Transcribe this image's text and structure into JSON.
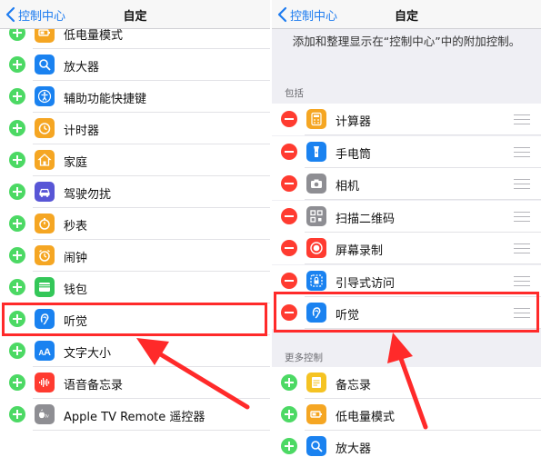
{
  "colors": {
    "ios_blue": "#1e7cf0",
    "add_green": "#4cd964",
    "remove_red": "#ff3b30",
    "highlight_red": "#ff2a2a"
  },
  "left": {
    "nav": {
      "back_label": "控制中心",
      "title": "自定"
    },
    "rows": [
      {
        "label": "低电量模式",
        "icon": "battery-icon",
        "icon_color": "#f5a623"
      },
      {
        "label": "放大器",
        "icon": "magnifier-icon",
        "icon_color": "#1a82f0"
      },
      {
        "label": "辅助功能快捷键",
        "icon": "accessibility-icon",
        "icon_color": "#1a82f0"
      },
      {
        "label": "计时器",
        "icon": "timer-icon",
        "icon_color": "#f5a623"
      },
      {
        "label": "家庭",
        "icon": "home-icon",
        "icon_color": "#f5a623"
      },
      {
        "label": "驾驶勿扰",
        "icon": "car-icon",
        "icon_color": "#5856d6"
      },
      {
        "label": "秒表",
        "icon": "stopwatch-icon",
        "icon_color": "#f5a623"
      },
      {
        "label": "闹钟",
        "icon": "alarm-icon",
        "icon_color": "#f5a623"
      },
      {
        "label": "钱包",
        "icon": "wallet-icon",
        "icon_color": "#34c759"
      },
      {
        "label": "听觉",
        "icon": "ear-icon",
        "icon_color": "#1a82f0"
      },
      {
        "label": "文字大小",
        "icon": "text-size-icon",
        "icon_color": "#1a82f0"
      },
      {
        "label": "语音备忘录",
        "icon": "voice-memo-icon",
        "icon_color": "#ff3b30"
      },
      {
        "label": "Apple TV Remote 遥控器",
        "icon": "apple-tv-icon",
        "icon_color": "#8e8e93"
      }
    ]
  },
  "right": {
    "nav": {
      "back_label": "控制中心",
      "title": "自定"
    },
    "description": "添加和整理显示在“控制中心”中的附加控制。",
    "included_header": "包括",
    "included_rows": [
      {
        "label": "计算器",
        "icon": "calculator-icon",
        "icon_color": "#f5a623"
      },
      {
        "label": "手电筒",
        "icon": "flashlight-icon",
        "icon_color": "#1a82f0"
      },
      {
        "label": "相机",
        "icon": "camera-icon",
        "icon_color": "#8e8e93"
      },
      {
        "label": "扫描二维码",
        "icon": "qr-code-icon",
        "icon_color": "#8e8e93"
      },
      {
        "label": "屏幕录制",
        "icon": "screen-record-icon",
        "icon_color": "#ff3b30"
      },
      {
        "label": "引导式访问",
        "icon": "guided-access-icon",
        "icon_color": "#1a82f0"
      },
      {
        "label": "听觉",
        "icon": "ear-icon",
        "icon_color": "#1a82f0"
      }
    ],
    "more_header": "更多控制",
    "more_rows": [
      {
        "label": "备忘录",
        "icon": "notes-icon",
        "icon_color": "#f5c323"
      },
      {
        "label": "低电量模式",
        "icon": "battery-icon",
        "icon_color": "#f5a623"
      },
      {
        "label": "放大器",
        "icon": "magnifier-icon",
        "icon_color": "#1a82f0"
      }
    ]
  }
}
